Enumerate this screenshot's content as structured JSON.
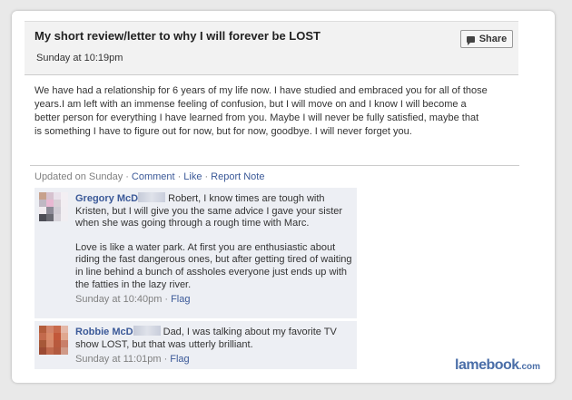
{
  "note": {
    "title": "My short review/letter to why I will forever be LOST",
    "date": "Sunday at 10:19pm",
    "share_label": "Share",
    "body": "We have had a relationship for 6 years of my life now. I have studied and embraced you for all of those years.I am left with an immense feeling of confusion, but I will move on and I know I will become a better person for everything I have learned from you. Maybe I will never be fully satisfied, maybe that is something I have to figure out for now, but for now, goodbye. I will never forget you."
  },
  "meta": {
    "updated": "Updated on Sunday",
    "comment": "Comment",
    "like": "Like",
    "report": "Report Note",
    "separator": "·"
  },
  "comments": [
    {
      "author": "Gregory McD",
      "text": "Robert, I know times are tough with Kristen, but I will give you the same advice I gave your sister when she was going through a rough time with Marc.",
      "text2": "Love is like a water park. At first you are enthusiastic about riding the fast dangerous ones, but after getting tired of waiting in line behind a bunch of assholes everyone just ends up with the fatties in the lazy river.",
      "time": "Sunday at 10:40pm",
      "flag": "Flag",
      "avatar_colors": [
        "#c7a18c",
        "#d6c2cf",
        "#e9e1ea",
        "#f3eff3",
        "#bfb8c3",
        "#e8b8d2",
        "#d9d0d7",
        "#f2eef2",
        "#f1ecf0",
        "#8c8a96",
        "#d0ccd4",
        "#f1eef2",
        "#4d4d55",
        "#6a6a72",
        "#d7d3da",
        "#f1eef2"
      ]
    },
    {
      "author": "Robbie McD",
      "text": "Dad, I was talking about my favorite TV show LOST, but that was utterly brilliant.",
      "time": "Sunday at 11:01pm",
      "flag": "Flag",
      "avatar_colors": [
        "#b35d3c",
        "#d2846a",
        "#c86a4c",
        "#e4b8a8",
        "#c36a4c",
        "#d98a68",
        "#c2583a",
        "#e0a890",
        "#a65838",
        "#d4876a",
        "#b85a3e",
        "#c87f6a",
        "#9c4a33",
        "#c06a4e",
        "#b25a40",
        "#d09a88"
      ]
    }
  ],
  "logo": {
    "main": "lamebook",
    "suffix": ".com"
  },
  "colors": {
    "link": "#3b5998",
    "comment_bg": "#edeff4",
    "meta_gray": "#808080"
  },
  "icons": {
    "share": "share-icon"
  }
}
